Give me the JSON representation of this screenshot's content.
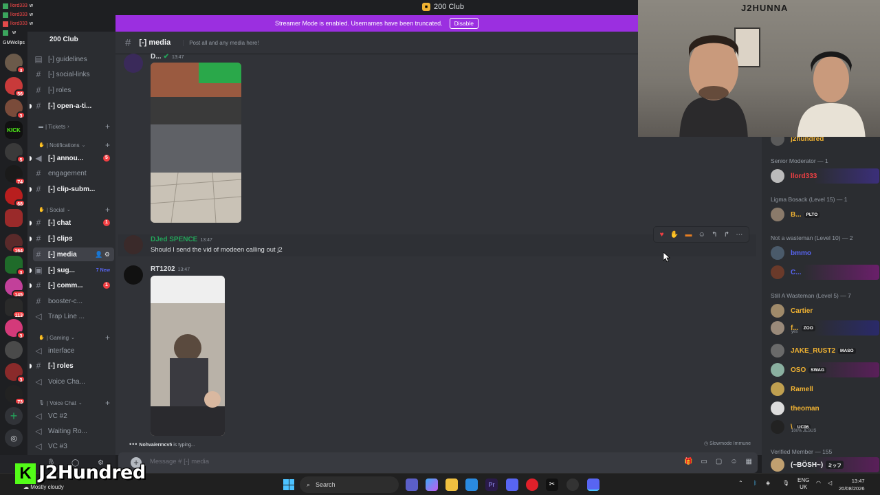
{
  "window": {
    "title": "200 Club"
  },
  "overlay_chat": [
    {
      "name": "llord333",
      "msg": "w"
    },
    {
      "name": "llord333",
      "msg": "w"
    },
    {
      "name": "llord333",
      "msg": "w"
    },
    {
      "name": "",
      "msg": "w"
    }
  ],
  "overlay_clip_label": "GMWclips",
  "server_name": "200 Club",
  "banner": {
    "text": "Streamer Mode is enabled. Usernames have been truncated.",
    "button": "Disable"
  },
  "servers": [
    {
      "badge": "3"
    },
    {
      "badge": "56"
    },
    {
      "badge": "3"
    },
    {
      "badge": "",
      "label": "KICK"
    },
    {
      "badge": "5"
    },
    {
      "badge": "74"
    },
    {
      "badge": "68"
    },
    {
      "badge": ""
    },
    {
      "badge": "164"
    },
    {
      "badge": "3"
    },
    {
      "badge": "145"
    },
    {
      "badge": "113"
    },
    {
      "badge": "3"
    },
    {
      "badge": ""
    },
    {
      "badge": "3"
    },
    {
      "badge": "73"
    }
  ],
  "channels": {
    "top": [
      {
        "label": "[-] guidelines",
        "type": "text",
        "unread": false
      },
      {
        "label": "[-] social-links",
        "type": "hash",
        "unread": false
      },
      {
        "label": "[-] roles",
        "type": "hash",
        "unread": false
      },
      {
        "label": "[-] open-a-ti...",
        "type": "hash",
        "unread": true
      }
    ],
    "cat_tickets": "| Tickets",
    "cat_notifications": "| Notifications",
    "notifications": [
      {
        "label": "[-] annou...",
        "type": "announce",
        "unread": true,
        "badge": "5"
      },
      {
        "label": "engagement",
        "type": "hash",
        "unread": false
      },
      {
        "label": "[-] clip-subm...",
        "type": "forum",
        "unread": true
      }
    ],
    "cat_social": "| Social",
    "social": [
      {
        "label": "[-] chat",
        "type": "hash",
        "unread": true,
        "badge": "1"
      },
      {
        "label": "[-] clips",
        "type": "hash",
        "unread": true
      },
      {
        "label": "[-] media",
        "type": "hash",
        "active": true
      },
      {
        "label": "[-] sug...",
        "type": "forum",
        "unread": true,
        "newtag": "7 New"
      },
      {
        "label": "[-] comm...",
        "type": "hash",
        "unread": true,
        "badge": "1"
      },
      {
        "label": "booster-c...",
        "type": "hash",
        "unread": false
      },
      {
        "label": "Trap Line ...",
        "type": "voice",
        "unread": false
      }
    ],
    "cat_gaming": "| Gaming",
    "gaming": [
      {
        "label": "interface",
        "type": "voice",
        "unread": false
      },
      {
        "label": "[-] roles",
        "type": "hash",
        "unread": true
      },
      {
        "label": "Voice Cha...",
        "type": "voice",
        "unread": false
      }
    ],
    "cat_voice": "| Voice Chat",
    "voice": [
      {
        "label": "VC #2",
        "type": "voice"
      },
      {
        "label": "Waiting Ro...",
        "type": "voice"
      },
      {
        "label": "VC #3",
        "type": "voice"
      }
    ]
  },
  "channel_header": {
    "name": "[-] media",
    "topic": "Post all and any media here!"
  },
  "messages": [
    {
      "user": "D...",
      "time": "13:47",
      "color": "#dbdee1"
    },
    {
      "user": "DJed SPENCE",
      "time": "13:47",
      "text": "Should I send the vid of modeen calling out j2",
      "color": "#23a55a"
    },
    {
      "user": "RT1202",
      "time": "13:47",
      "color": "#dbdee1"
    }
  ],
  "typing": {
    "who": "Nohva/ermcv5",
    "suffix": "is typing..."
  },
  "slowmode": "Slowmode Immune",
  "composer": {
    "placeholder": "Message # [-] media"
  },
  "overlay_streamer_name": "J2Hundred",
  "weather": "Mostly cloudy",
  "webcam_sign": "J2HUNNA",
  "members": {
    "top_name": "j2hundred",
    "groups": [
      {
        "title": "Senior Moderator — 1",
        "members": [
          {
            "name": "llord333",
            "color": "#f23f43",
            "tag": ""
          }
        ]
      },
      {
        "title": "Ligma Bosack (Level 15) — 1",
        "members": [
          {
            "name": "B...",
            "color": "#f0b232",
            "tag": "PLTO"
          }
        ]
      },
      {
        "title": "Not a wasteman (Level 10) — 2",
        "members": [
          {
            "name": "bmmo",
            "color": "#5865f2",
            "tag": ""
          },
          {
            "name": "C...",
            "color": "#5865f2",
            "tag": ""
          }
        ]
      },
      {
        "title": "Still A Wasteman (Level 5) — 7",
        "members": [
          {
            "name": "Cartier",
            "color": "#f0b232",
            "tag": ""
          },
          {
            "name": "f...",
            "color": "#f0b232",
            "tag": "ZOO",
            "sub": "yes"
          },
          {
            "name": "JAKE_RUST2",
            "color": "#f0b232",
            "tag": "MASO"
          },
          {
            "name": "OSO",
            "color": "#f0b232",
            "tag": "SWAG"
          },
          {
            "name": "Ramell",
            "color": "#f0b232",
            "tag": ""
          },
          {
            "name": "theoman",
            "color": "#f0b232",
            "tag": ""
          },
          {
            "name": "\\",
            "color": "#f0b232",
            "tag": "UC06",
            "sub": "100% JESUS"
          }
        ]
      },
      {
        "title": "Verified Member — 155",
        "members": [
          {
            "name": "(~BÖSH~)",
            "color": "#f2f3f5",
            "tag": "ミッフ"
          }
        ]
      }
    ]
  },
  "taskbar": {
    "search_placeholder": "Search",
    "lang_top": "ENG",
    "lang_bottom": "UK",
    "time": "13:47",
    "date": "20/08/2026"
  }
}
